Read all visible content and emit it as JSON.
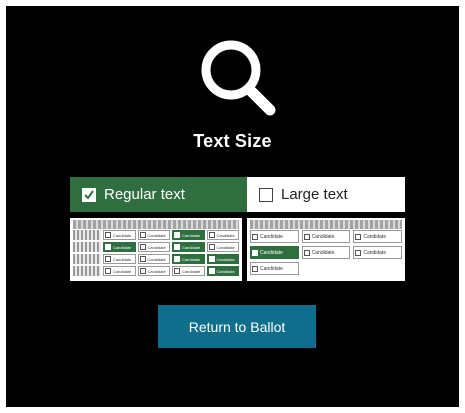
{
  "page": {
    "title": "Text Size",
    "icon": "magnifying-glass-icon",
    "accent_color": "#2f6f3f",
    "button_color": "#0e6e8c"
  },
  "options": [
    {
      "label": "Regular text",
      "selected": true
    },
    {
      "label": "Large text",
      "selected": false
    }
  ],
  "previews": {
    "regular": {
      "cells": [
        "Candidate",
        "Candidate",
        "Candidate",
        "Candidate",
        "Candidate",
        "Candidate",
        "Candidate",
        "Candidate",
        "Candidate",
        "Candidate",
        "Candidate",
        "Candidate",
        "Candidate",
        "Candidate",
        "Candidate",
        "Candidate"
      ],
      "selected": [
        2,
        4,
        6,
        10,
        11,
        15
      ]
    },
    "large": {
      "cells": [
        "Candidate",
        "Candidate",
        "Candidate",
        "Candidate",
        "Candidate",
        "Candidate",
        "Candidate"
      ],
      "selected": [
        3
      ]
    }
  },
  "return_button": {
    "label": "Return to Ballot"
  }
}
